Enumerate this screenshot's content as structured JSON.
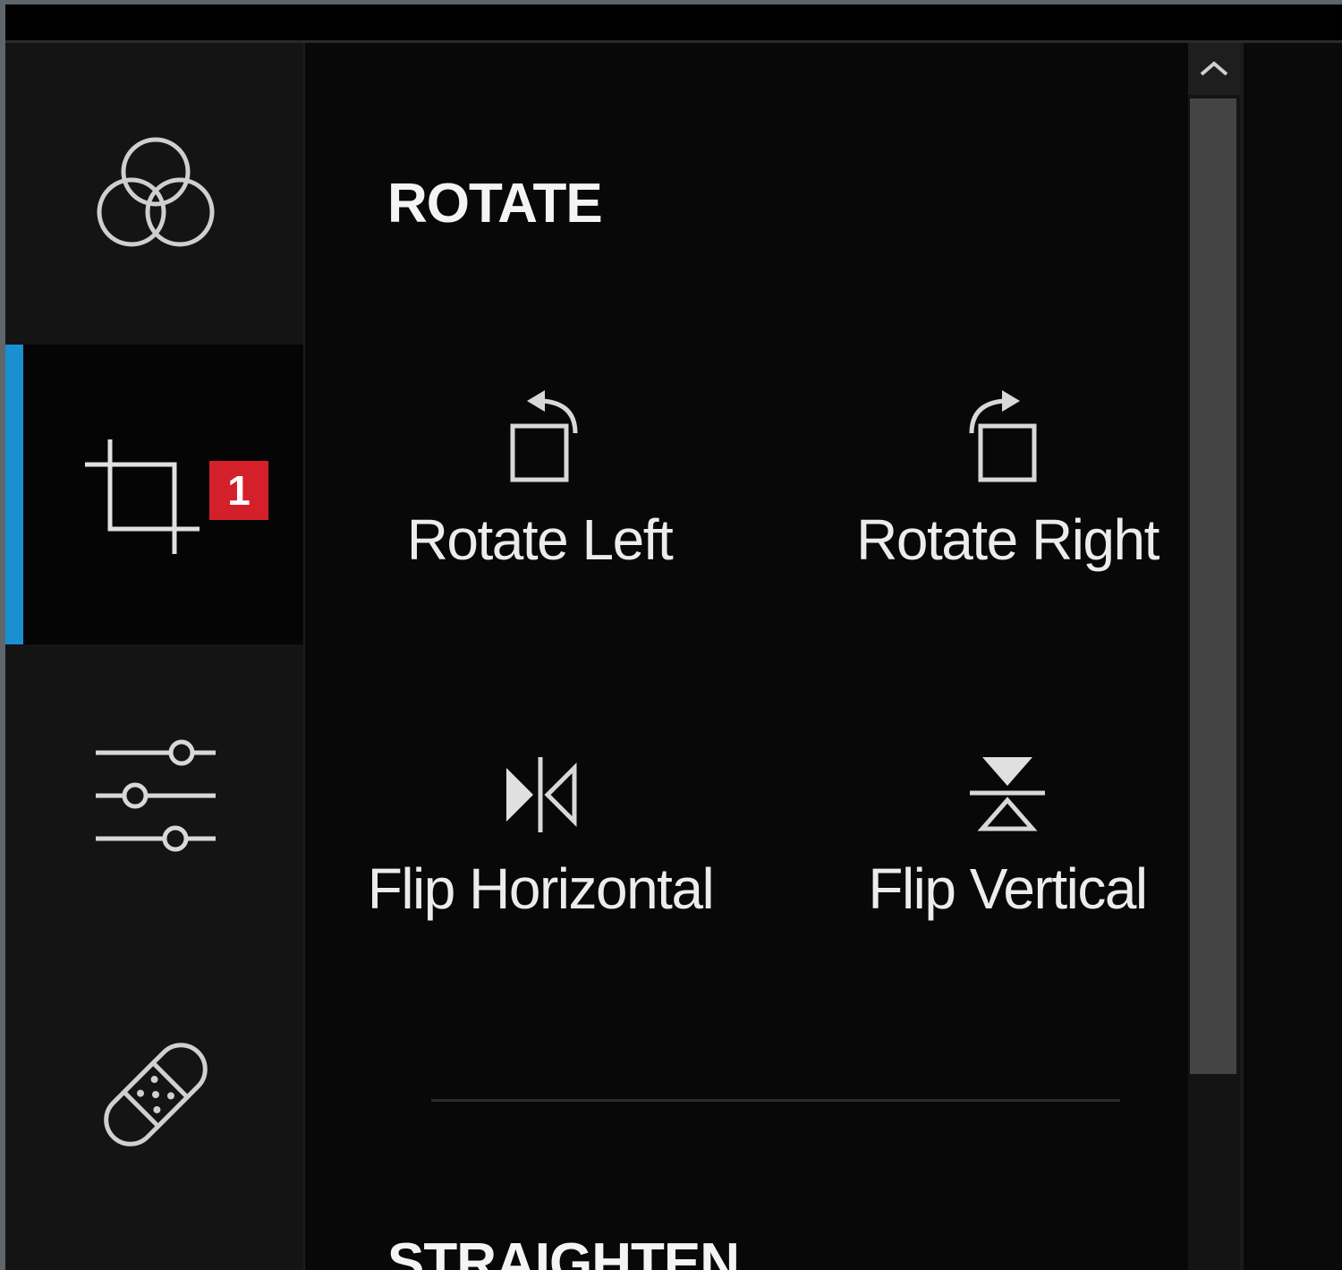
{
  "rail": {
    "items": [
      {
        "name": "color-icon"
      },
      {
        "name": "crop-icon",
        "active": true,
        "badge": "1"
      },
      {
        "name": "adjust-sliders-icon"
      },
      {
        "name": "healing-bandage-icon"
      }
    ],
    "accent_color": "#1a8fd1",
    "badge_color": "#d3202a"
  },
  "panel": {
    "rotate_title": "ROTATE",
    "tools": {
      "rotate_left": "Rotate Left",
      "rotate_right": "Rotate Right",
      "flip_horizontal": "Flip Horizontal",
      "flip_vertical": "Flip Vertical"
    },
    "straighten_title": "STRAIGHTEN"
  },
  "scrollbar": {
    "up_icon": "chevron-up-icon"
  }
}
